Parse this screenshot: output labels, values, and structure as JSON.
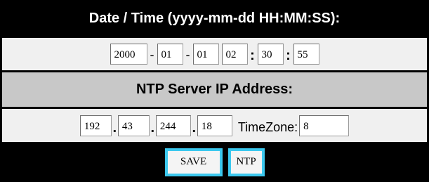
{
  "datetime_section": {
    "header": "Date / Time (yyyy-mm-dd HH:MM:SS):",
    "year": "2000",
    "month": "01",
    "day": "01",
    "hour": "02",
    "minute": "30",
    "second": "55",
    "date_separator": "-",
    "time_separator": ":"
  },
  "ntp_section": {
    "header": "NTP Server IP Address:",
    "ip_octet_1": "192",
    "ip_octet_2": "43",
    "ip_octet_3": "244",
    "ip_octet_4": "18",
    "ip_separator": ".",
    "timezone_label": "TimeZone:",
    "timezone_value": "8"
  },
  "actions": {
    "save_label": "SAVE",
    "ntp_label": "NTP"
  },
  "colors": {
    "header_background": "#000000",
    "header_text": "#ffffff",
    "section_header_background": "#c8c8c8",
    "row_background": "#f0f0f0",
    "button_border": "#3cc8ee"
  }
}
